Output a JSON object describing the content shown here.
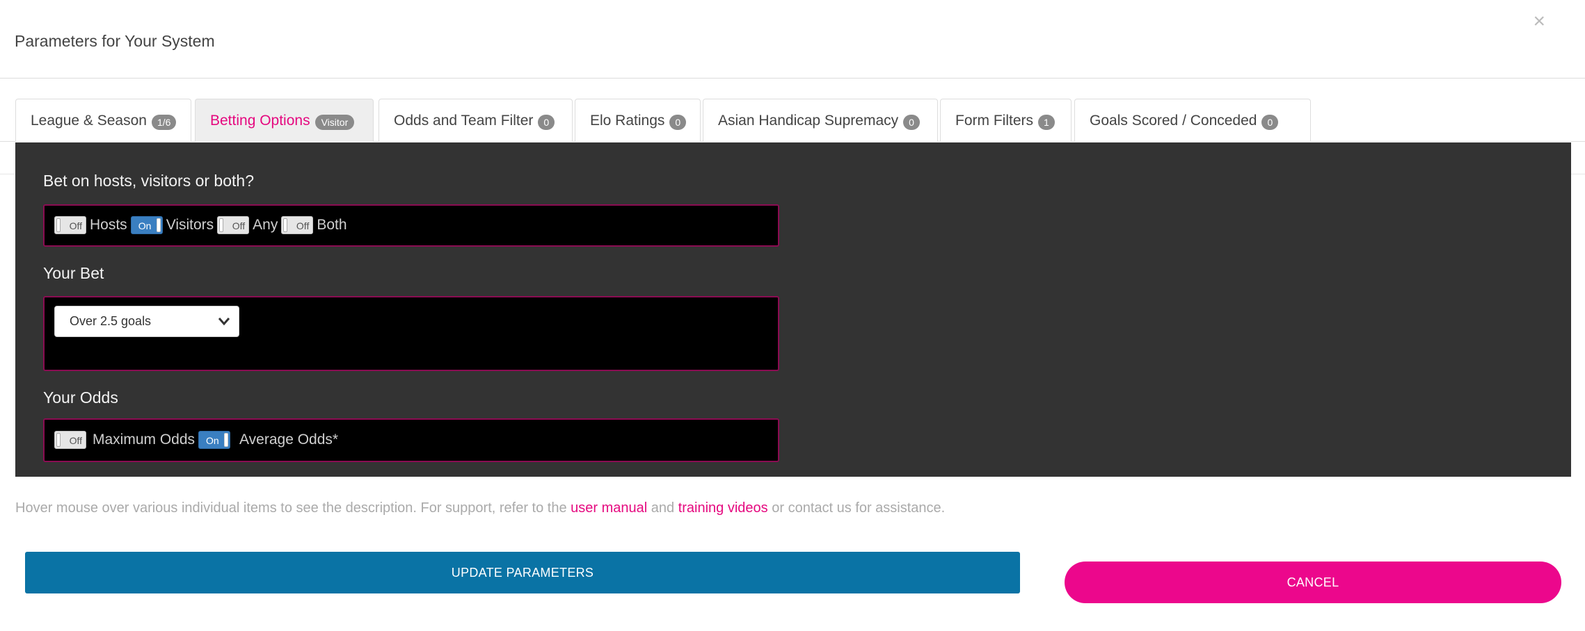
{
  "modal": {
    "title": "Parameters for Your System",
    "close_label": "×"
  },
  "tabs": [
    {
      "label": "League & Season",
      "badge": "1/6",
      "active": false
    },
    {
      "label": "Betting Options",
      "badge": "Visitor",
      "active": true
    },
    {
      "label": "Odds and Team Filter",
      "badge": "0",
      "active": false
    },
    {
      "label": "Elo Ratings",
      "badge": "0",
      "active": false
    },
    {
      "label": "Asian Handicap Supremacy",
      "badge": "0",
      "active": false
    },
    {
      "label": "Form Filters",
      "badge": "1",
      "active": false
    },
    {
      "label": "Goals Scored / Conceded",
      "badge": "0",
      "active": false
    }
  ],
  "bet_on": {
    "label": "Bet on hosts, visitors or both?",
    "toggles": [
      {
        "state": "Off",
        "label": "Hosts"
      },
      {
        "state": "On",
        "label": "Visitors"
      },
      {
        "state": "Off",
        "label": "Any"
      },
      {
        "state": "Off",
        "label": "Both"
      }
    ]
  },
  "your_bet": {
    "label": "Your Bet",
    "selected": "Over 2.5 goals"
  },
  "your_odds": {
    "label": "Your Odds",
    "toggles": [
      {
        "state": "Off",
        "label": "Maximum Odds"
      },
      {
        "state": "On",
        "label": "Average Odds*"
      }
    ]
  },
  "help": {
    "prefix": "Hover mouse over various individual items to see the description. For support, refer to the ",
    "link1": "user manual",
    "middle": " and ",
    "link2": "training videos",
    "suffix": " or contact us for assistance."
  },
  "buttons": {
    "update": "UPDATE PARAMETERS",
    "cancel": "CANCEL"
  },
  "colors": {
    "accent": "#e5097f",
    "primary_button": "#0a73a5",
    "cancel_button": "#ec078c",
    "toggle_on": "#3a7fc1",
    "panel_bg": "#333333",
    "box_border": "#8b0c52"
  }
}
